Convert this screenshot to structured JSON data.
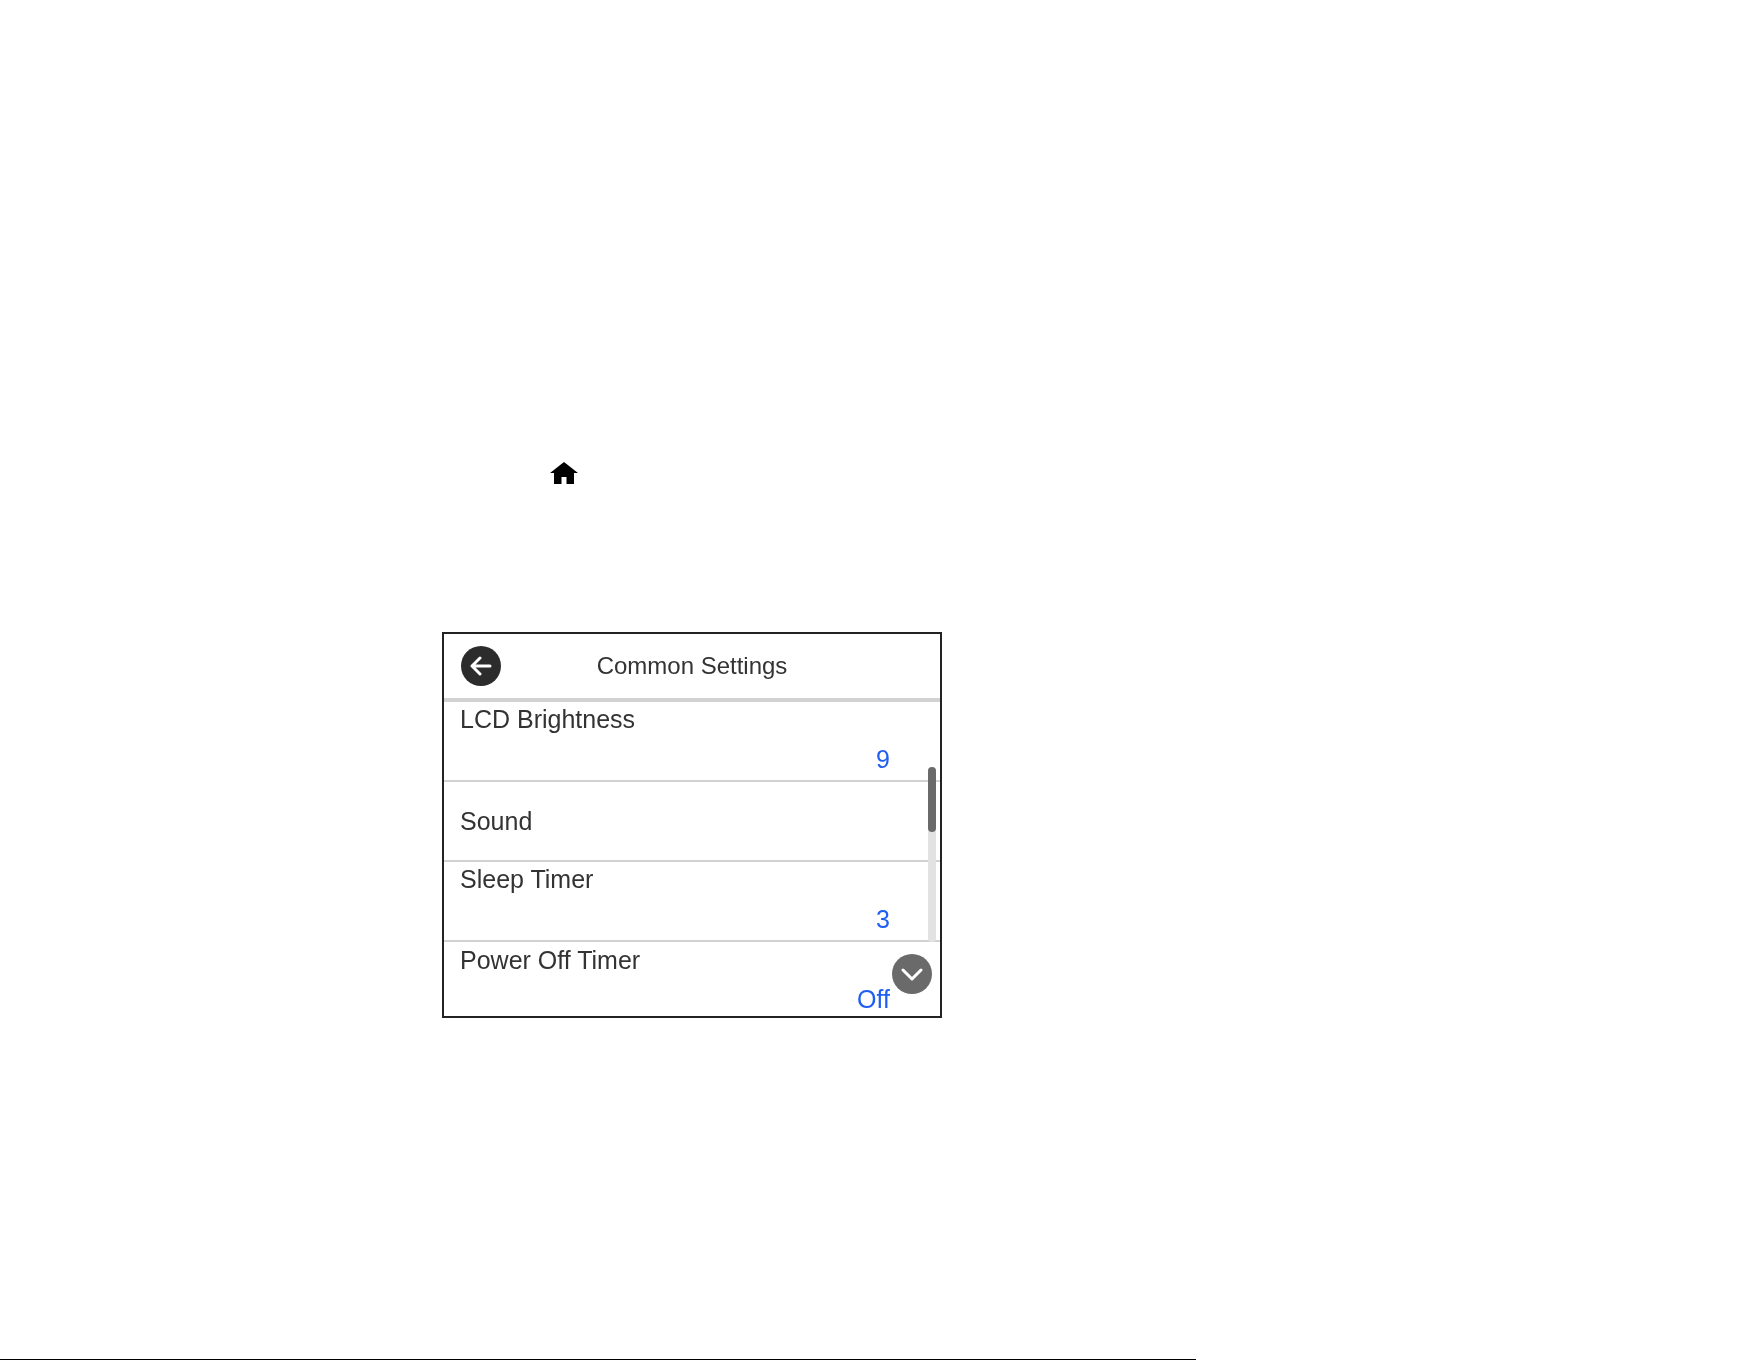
{
  "screen": {
    "title": "Common Settings",
    "items": [
      {
        "label": "LCD Brightness",
        "value": "9"
      },
      {
        "label": "Sound"
      },
      {
        "label": "Sleep Timer",
        "value": "3"
      },
      {
        "label": "Power Off Timer",
        "value": "Off"
      }
    ]
  }
}
